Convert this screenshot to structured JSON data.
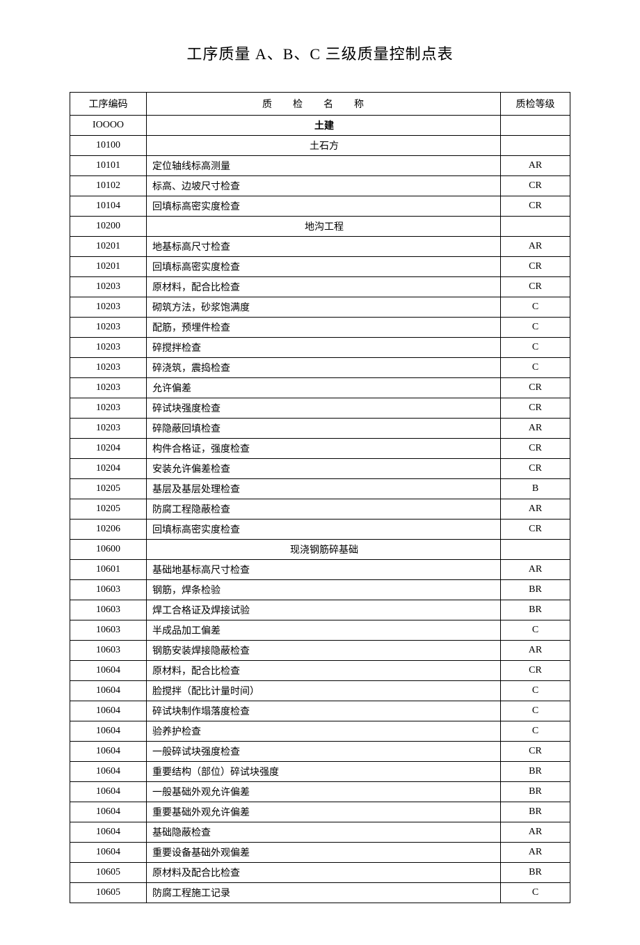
{
  "title": "工序质量 A、B、C 三级质量控制点表",
  "headers": {
    "code": "工序编码",
    "name": "质检名称",
    "grade": "质检等级"
  },
  "rows": [
    {
      "code": "IOOOO",
      "name": "土建",
      "grade": "",
      "type": "section"
    },
    {
      "code": "10100",
      "name": "土石方",
      "grade": "",
      "type": "subsection"
    },
    {
      "code": "10101",
      "name": "定位轴线标高测量",
      "grade": "AR",
      "type": "item"
    },
    {
      "code": "10102",
      "name": "标高、边坡尺寸检查",
      "grade": "CR",
      "type": "item"
    },
    {
      "code": "10104",
      "name": "回填标高密实度检查",
      "grade": "CR",
      "type": "item"
    },
    {
      "code": "10200",
      "name": "地沟工程",
      "grade": "",
      "type": "subsection"
    },
    {
      "code": "10201",
      "name": "地基标高尺寸检查",
      "grade": "AR",
      "type": "item"
    },
    {
      "code": "10201",
      "name": "回填标高密实度检查",
      "grade": "CR",
      "type": "item"
    },
    {
      "code": "10203",
      "name": "原材料，配合比检查",
      "grade": "CR",
      "type": "item"
    },
    {
      "code": "10203",
      "name": "砌筑方法，砂浆饱满度",
      "grade": "C",
      "type": "item"
    },
    {
      "code": "10203",
      "name": "配筋，预埋件检查",
      "grade": "C",
      "type": "item"
    },
    {
      "code": "10203",
      "name": "碎搅拌检查",
      "grade": "C",
      "type": "item"
    },
    {
      "code": "10203",
      "name": "碎浇筑，震捣检查",
      "grade": "C",
      "type": "item"
    },
    {
      "code": "10203",
      "name": "允许偏差",
      "grade": "CR",
      "type": "item"
    },
    {
      "code": "10203",
      "name": "碎试块强度检查",
      "grade": "CR",
      "type": "item"
    },
    {
      "code": "10203",
      "name": "碎隐蔽回填检查",
      "grade": "AR",
      "type": "item"
    },
    {
      "code": "10204",
      "name": "构件合格证，强度检查",
      "grade": "CR",
      "type": "item"
    },
    {
      "code": "10204",
      "name": "安装允许偏差检查",
      "grade": "CR",
      "type": "item"
    },
    {
      "code": "10205",
      "name": "基层及基层处理检查",
      "grade": "B",
      "type": "item"
    },
    {
      "code": "10205",
      "name": "防腐工程隐蔽检查",
      "grade": "AR",
      "type": "item"
    },
    {
      "code": "10206",
      "name": "回填标高密实度检查",
      "grade": "CR",
      "type": "item"
    },
    {
      "code": "10600",
      "name": "现浇钢筋碎基础",
      "grade": "",
      "type": "subsection"
    },
    {
      "code": "10601",
      "name": "基础地基标高尺寸检查",
      "grade": "AR",
      "type": "item"
    },
    {
      "code": "10603",
      "name": "钢筋，焊条检验",
      "grade": "BR",
      "type": "item"
    },
    {
      "code": "10603",
      "name": "焊工合格证及焊接试验",
      "grade": "BR",
      "type": "item"
    },
    {
      "code": "10603",
      "name": "半成品加工偏差",
      "grade": "C",
      "type": "item"
    },
    {
      "code": "10603",
      "name": "钢筋安装焊接隐蔽检查",
      "grade": "AR",
      "type": "item"
    },
    {
      "code": "10604",
      "name": "原材料，配合比检查",
      "grade": "CR",
      "type": "item"
    },
    {
      "code": "10604",
      "name": "脸搅拌（配比计量时间）",
      "grade": "C",
      "type": "item"
    },
    {
      "code": "10604",
      "name": "碎试块制作塌落度检查",
      "grade": "C",
      "type": "item"
    },
    {
      "code": "10604",
      "name": "验养护检查",
      "grade": "C",
      "type": "item"
    },
    {
      "code": "10604",
      "name": "一般碎试块强度检查",
      "grade": "CR",
      "type": "item"
    },
    {
      "code": "10604",
      "name": "重要结构（部位）碎试块强度",
      "grade": "BR",
      "type": "item"
    },
    {
      "code": "10604",
      "name": "一般基础外观允许偏差",
      "grade": "BR",
      "type": "item"
    },
    {
      "code": "10604",
      "name": "重要基础外观允许偏差",
      "grade": "BR",
      "type": "item"
    },
    {
      "code": "10604",
      "name": "基础隐蔽检查",
      "grade": "AR",
      "type": "item"
    },
    {
      "code": "10604",
      "name": "重要设备基础外观偏差",
      "grade": "AR",
      "type": "item"
    },
    {
      "code": "10605",
      "name": "原材料及配合比检查",
      "grade": "BR",
      "type": "item"
    },
    {
      "code": "10605",
      "name": "防腐工程施工记录",
      "grade": "C",
      "type": "item"
    }
  ]
}
